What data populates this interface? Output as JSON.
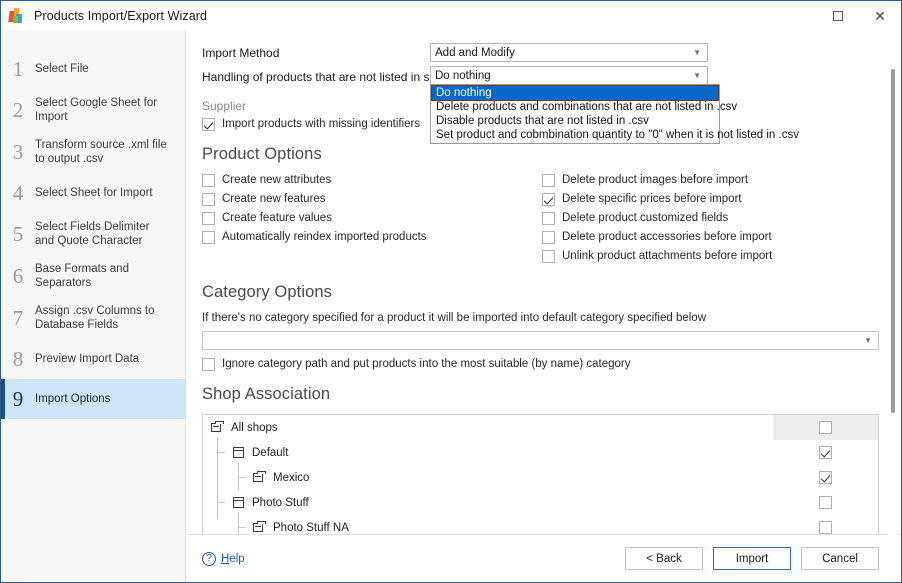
{
  "window": {
    "title": "Products Import/Export Wizard",
    "icon": "app-logo-icon",
    "maximize_label": "",
    "close_label": "✕"
  },
  "sidebar": {
    "steps": [
      {
        "num": "1",
        "label": "Select File",
        "active": false
      },
      {
        "num": "2",
        "label": "Select Google Sheet for Import",
        "active": false
      },
      {
        "num": "3",
        "label": "Transform source .xml file to output .csv",
        "active": false
      },
      {
        "num": "4",
        "label": "Select Sheet for Import",
        "active": false
      },
      {
        "num": "5",
        "label": "Select Fields Delimiter and Quote Character",
        "active": false
      },
      {
        "num": "6",
        "label": "Base Formats and Separators",
        "active": false
      },
      {
        "num": "7",
        "label": "Assign .csv Columns to Database Fields",
        "active": false
      },
      {
        "num": "8",
        "label": "Preview Import Data",
        "active": false
      },
      {
        "num": "9",
        "label": "Import Options",
        "active": true
      }
    ]
  },
  "main": {
    "import_method": {
      "label": "Import Method",
      "value": "Add and Modify"
    },
    "handling": {
      "label": "Handling of products that are not listed in source file",
      "value": "Do nothing",
      "open": true,
      "options": [
        "Do nothing",
        "Delete products and combinations that are not listed in .csv",
        "Disable products that are not listed in .csv",
        "Set product and cobmbination quantity to \"0\" when it is not listed in .csv"
      ],
      "selected_index": 0
    },
    "supplier": {
      "label": "Supplier",
      "missing_identifiers": {
        "label": "Import products with missing identifiers",
        "checked": true
      }
    },
    "product_options": {
      "title": "Product Options",
      "left": [
        {
          "label": "Create new attributes",
          "checked": false
        },
        {
          "label": "Create new features",
          "checked": false
        },
        {
          "label": "Create feature values",
          "checked": false
        },
        {
          "label": "Automatically reindex imported products",
          "checked": false
        }
      ],
      "right": [
        {
          "label": "Delete product images before import",
          "checked": false
        },
        {
          "label": "Delete specific prices before import",
          "checked": true
        },
        {
          "label": "Delete product customized fields",
          "checked": false
        },
        {
          "label": "Delete product accessories before import",
          "checked": false
        },
        {
          "label": "Unlink product attachments before import",
          "checked": false
        }
      ]
    },
    "category_options": {
      "title": "Category Options",
      "hint": "If there's no category specified for a product it will be imported into default category specified below",
      "default_category": "",
      "ignore_path": {
        "label": "Ignore category path and put products into the most suitable (by name) category",
        "checked": false
      }
    },
    "shop_association": {
      "title": "Shop Association",
      "rows": [
        {
          "label": "All shops",
          "icon": "shop-group-icon",
          "level": 0,
          "checked": false,
          "header": true
        },
        {
          "label": "Default",
          "icon": "shop-icon",
          "level": 1,
          "checked": true,
          "header": false
        },
        {
          "label": "Mexico",
          "icon": "shop-group-icon",
          "level": 2,
          "checked": true,
          "header": false
        },
        {
          "label": "Photo Stuff",
          "icon": "shop-icon",
          "level": 1,
          "checked": false,
          "header": false
        },
        {
          "label": "Photo Stuff NA",
          "icon": "shop-group-icon",
          "level": 2,
          "checked": false,
          "header": false
        }
      ]
    }
  },
  "footer": {
    "help": "Help",
    "help_mnemonic": "H",
    "back": "< Back",
    "back_mnemonic": "B",
    "import": "Import",
    "import_mnemonic": "I",
    "cancel": "Cancel",
    "cancel_mnemonic": "C"
  },
  "colors": {
    "accent": "#1f4e79",
    "active_step_bg": "#cde6f7",
    "dropdown_highlight": "#0a68c8",
    "link": "#1661b8",
    "window_border": "#2d5c8a"
  }
}
